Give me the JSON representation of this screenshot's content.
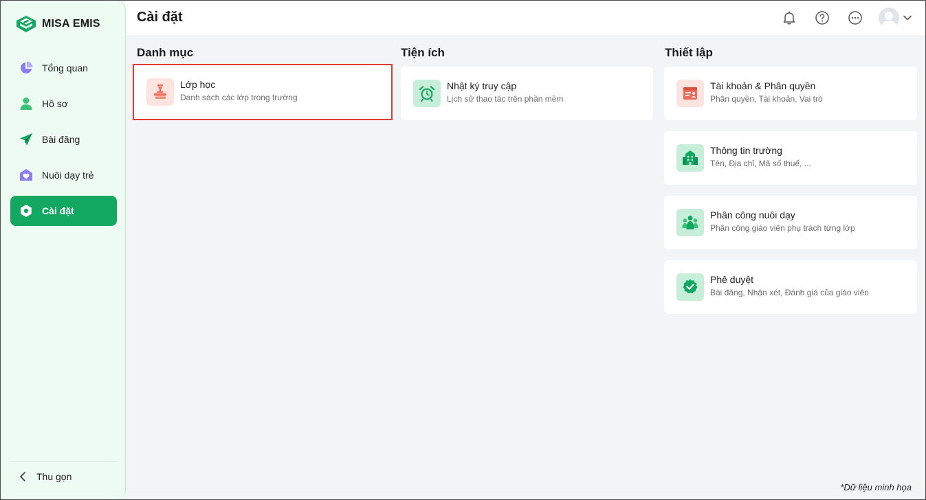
{
  "app": {
    "brand": "MISA EMIS"
  },
  "colors": {
    "primary": "#12a861",
    "sidebar_bg": "#eefbf3",
    "selection": "#e53935",
    "icon_red": "#f06a55",
    "icon_green": "#12a861"
  },
  "sidebar": {
    "items": [
      {
        "label": "Tổng quan",
        "icon": "pie-chart-icon"
      },
      {
        "label": "Hồ sơ",
        "icon": "person-icon"
      },
      {
        "label": "Bài đăng",
        "icon": "paper-plane-icon"
      },
      {
        "label": "Nuôi dạy trẻ",
        "icon": "heart-house-icon"
      },
      {
        "label": "Cài đặt",
        "icon": "gear-icon",
        "active": true
      }
    ],
    "collapse_label": "Thu gọn"
  },
  "header": {
    "title": "Cài đặt",
    "icons": [
      "bell-icon",
      "help-icon",
      "more-icon",
      "avatar",
      "chevron-down-icon"
    ]
  },
  "sections": [
    {
      "title": "Danh mục",
      "cards": [
        {
          "title": "Lớp học",
          "subtitle": "Danh sách các lớp trong trường",
          "icon": "classroom-icon",
          "selected": true
        }
      ]
    },
    {
      "title": "Tiện ích",
      "cards": [
        {
          "title": "Nhật ký truy cập",
          "subtitle": "Lịch sử thao tác trên phần mềm",
          "icon": "alarm-clock-icon"
        }
      ]
    },
    {
      "title": "Thiết lập",
      "cards": [
        {
          "title": "Tài khoản & Phân quyền",
          "subtitle": "Phân quyền, Tài khoản, Vai trò",
          "icon": "account-icon"
        },
        {
          "title": "Thông tin trường",
          "subtitle": "Tên, Địa chỉ, Mã số thuế, ...",
          "icon": "school-building-icon"
        },
        {
          "title": "Phân công nuôi dạy",
          "subtitle": "Phân công giáo viên phụ trách từng lớp",
          "icon": "group-icon"
        },
        {
          "title": "Phê duyệt",
          "subtitle": "Bài đăng, Nhận xét, Đánh giá của giáo viên",
          "icon": "approved-badge-icon"
        }
      ]
    }
  ],
  "footnote": "*Dữ liệu minh họa"
}
